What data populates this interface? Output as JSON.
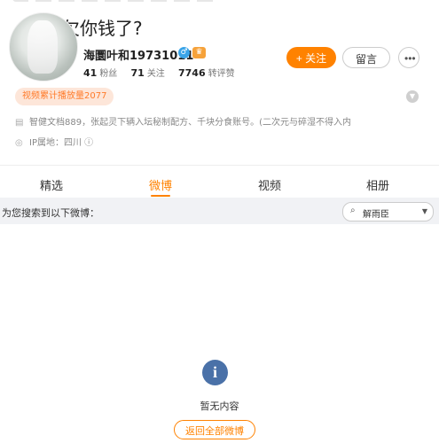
{
  "profile": {
    "banner_text": "欠你钱了?",
    "name": "海圜叶和19731011",
    "verified_icon": "verified-icon",
    "vip_icon": "crown-icon",
    "stats": [
      {
        "value": "41",
        "label": "粉丝"
      },
      {
        "value": "71",
        "label": "关注"
      },
      {
        "value": "7746",
        "label": "转评赞"
      }
    ],
    "follow_label": "+ 关注",
    "message_label": "留言",
    "more_label": "•••",
    "play_count_label": "视频累计播放量2077",
    "bio": "智健文档889，张起灵下辆入坛秘制配方、千块分食账号。(二次元与碎湿不得入内",
    "ip_label": "IP属地：四川 ⓘ"
  },
  "tabs": [
    {
      "label": "精选"
    },
    {
      "label": "微博",
      "active": true
    },
    {
      "label": "视频"
    },
    {
      "label": "相册"
    }
  ],
  "search": {
    "label": "为您搜索到以下微博：",
    "selected": "解雨臣"
  },
  "empty": {
    "icon": "info-icon",
    "text": "暂无内容",
    "return_label": "返回全部微博"
  },
  "colors": {
    "accent": "#ff8200",
    "info_icon": "#4a71a8",
    "search_bar_bg": "#f1f2f5"
  }
}
